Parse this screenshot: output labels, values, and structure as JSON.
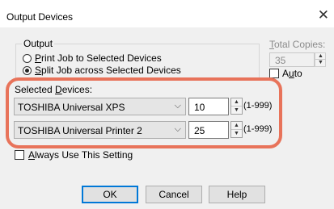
{
  "window": {
    "title": "Output Devices",
    "close_glyph": "✕"
  },
  "output_group": {
    "label": "Output",
    "options": [
      {
        "text": "Print Job to Selected Devices",
        "hotkey": "P",
        "rest": "rint Job to Selected Devices",
        "selected": false
      },
      {
        "text": "Split Job across Selected Devices",
        "hotkey": "S",
        "rest": "plit Job across Selected Devices",
        "selected": true
      }
    ]
  },
  "total_copies": {
    "label": "Total Copies:",
    "hotkey": "T",
    "rest": "otal Copies:",
    "value": "35",
    "enabled": false
  },
  "auto": {
    "label": "Auto",
    "hotkey": "u",
    "pre": "A",
    "post": "to",
    "checked": false
  },
  "selected_devices": {
    "label": "Selected Devices:",
    "pre": "Selected ",
    "hotkey": "D",
    "post": "evices:",
    "rows": [
      {
        "device": "TOSHIBA Universal XPS",
        "count": "10",
        "range": "(1-999)"
      },
      {
        "device": "TOSHIBA Universal Printer 2",
        "count": "25",
        "range": "(1-999)"
      }
    ]
  },
  "always_use": {
    "label": "Always Use This Setting",
    "hotkey": "A",
    "rest": "lways Use This Setting",
    "checked": false
  },
  "buttons": {
    "ok": "OK",
    "cancel": "Cancel",
    "help": "Help"
  },
  "colors": {
    "highlight": "#e8735a",
    "default_button_border": "#0078d7",
    "dialog_bg": "#f0f0f0"
  }
}
